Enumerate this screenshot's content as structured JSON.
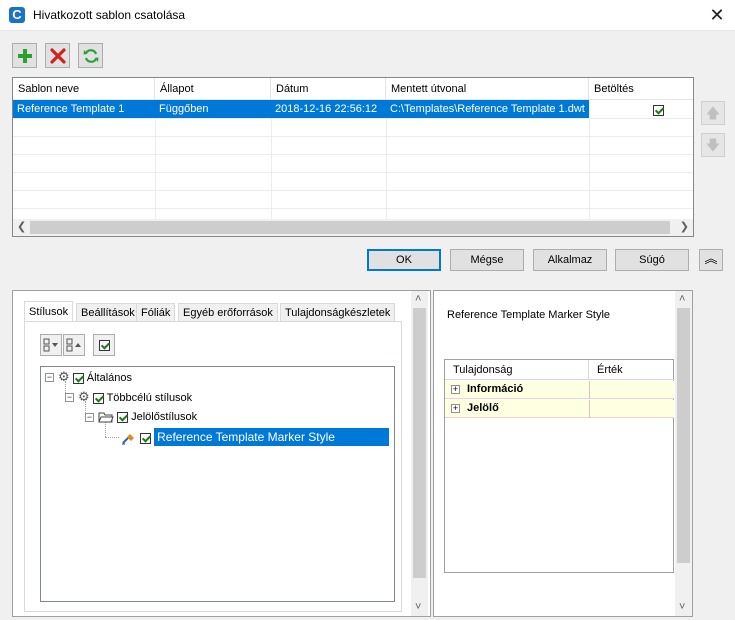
{
  "window": {
    "title": "Hivatkozott sablon csatolása",
    "app_icon": "C"
  },
  "grid": {
    "columns": [
      "Sablon neve",
      "Állapot",
      "Dátum",
      "Mentett útvonal",
      "Betöltés"
    ],
    "rows": [
      {
        "name": "Reference Template 1",
        "status": "Függőben",
        "date": "2018-12-16 22:56:12",
        "path": "C:\\Templates\\Reference Template 1.dwt",
        "load": true
      }
    ]
  },
  "buttons": {
    "ok": "OK",
    "cancel": "Mégse",
    "apply": "Alkalmaz",
    "help": "Súgó"
  },
  "tabs": [
    "Stílusok",
    "Beállítások",
    "Fóliák",
    "Egyéb erőforrások",
    "Tulajdonságkészletek"
  ],
  "tree": {
    "root": "Általános",
    "child": "Többcélú stílusok",
    "grandchild": "Jelölőstílusok",
    "leaf": "Reference Template Marker Style"
  },
  "details": {
    "title": "Reference Template Marker Style",
    "col_property": "Tulajdonság",
    "col_value": "Érték",
    "rows": [
      "Információ",
      "Jelölő"
    ]
  },
  "colors": {
    "selection": "#0078d7",
    "add": "#2ca02c",
    "delete": "#d62020",
    "refresh": "#2e9e3e"
  }
}
